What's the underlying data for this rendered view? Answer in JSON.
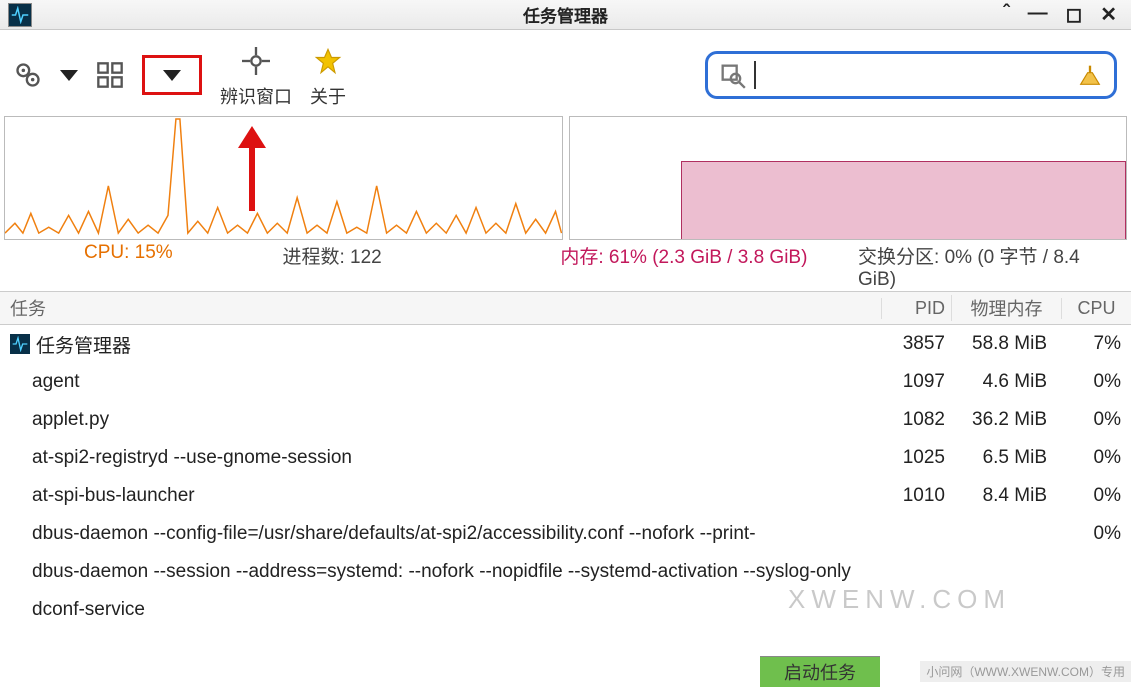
{
  "window": {
    "title": "任务管理器",
    "app_name": "任务管理器"
  },
  "toolbar": {
    "identify_window": "辨识窗口",
    "about": "关于"
  },
  "search": {
    "value": "",
    "placeholder": ""
  },
  "stats": {
    "cpu_label": "CPU: 15%",
    "processes_label": "进程数: 122",
    "memory_label": "内存: 61% (2.3 GiB / 3.8 GiB)",
    "swap_label": "交换分区: 0% (0 字节 / 8.4 GiB)"
  },
  "columns": {
    "task": "任务",
    "pid": "PID",
    "memory": "物理内存",
    "cpu": "CPU"
  },
  "rows": [
    {
      "icon": true,
      "name": "任务管理器",
      "pid": "3857",
      "mem": "58.8 MiB",
      "cpu": "7%"
    },
    {
      "icon": false,
      "name": "agent",
      "pid": "1097",
      "mem": "4.6 MiB",
      "cpu": "0%"
    },
    {
      "icon": false,
      "name": "applet.py",
      "pid": "1082",
      "mem": "36.2 MiB",
      "cpu": "0%"
    },
    {
      "icon": false,
      "name": "at-spi2-registryd --use-gnome-session",
      "pid": "1025",
      "mem": "6.5 MiB",
      "cpu": "0%"
    },
    {
      "icon": false,
      "name": "at-spi-bus-launcher",
      "pid": "1010",
      "mem": "8.4 MiB",
      "cpu": "0%"
    },
    {
      "icon": false,
      "name": "dbus-daemon --config-file=/usr/share/defaults/at-spi2/accessibility.conf --nofork --print-",
      "pid": "",
      "mem": "",
      "cpu": "0%"
    },
    {
      "icon": false,
      "name": "dbus-daemon --session --address=systemd: --nofork --nopidfile --systemd-activation --syslog-only",
      "pid": "",
      "mem": "",
      "cpu": ""
    },
    {
      "icon": false,
      "name": "dconf-service",
      "pid": "",
      "mem": "",
      "cpu": ""
    }
  ],
  "footer": {
    "start_task": "启动任务",
    "watermark_small": "小问网（WWW.XWENW.COM）专用",
    "watermark_big": "XWENW.COM"
  },
  "colors": {
    "cpu_line": "#f08010",
    "mem_fill": "#c2185b",
    "highlight_box": "#d11919",
    "search_border": "#2f6fd6"
  }
}
